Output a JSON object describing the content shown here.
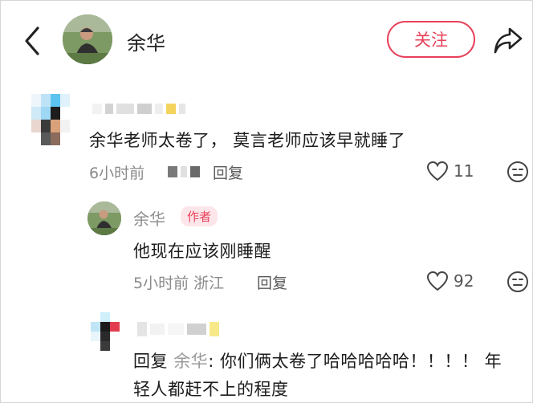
{
  "header": {
    "title": "余华",
    "follow_label": "关注",
    "accent": "#e8415a"
  },
  "comments": [
    {
      "text": "余华老师太卷了， 莫言老师应该早就睡了",
      "time": "6小时前",
      "reply_label": "回复",
      "likes": "11"
    }
  ],
  "reply1": {
    "author": "余华",
    "badge": "作者",
    "text": "他现在应该刚睡醒",
    "time": "5小时前",
    "location": "浙江",
    "reply_label": "回复",
    "likes": "92"
  },
  "reply2": {
    "prefix": "回复",
    "to": "余华",
    "text_line1": ": 你们俩太卷了哈哈哈哈哈！！！！ 年",
    "text_line2": "轻人都赶不上的程度"
  },
  "icons": [
    "back-icon",
    "share-icon",
    "heart-icon",
    "emoji-icon"
  ]
}
